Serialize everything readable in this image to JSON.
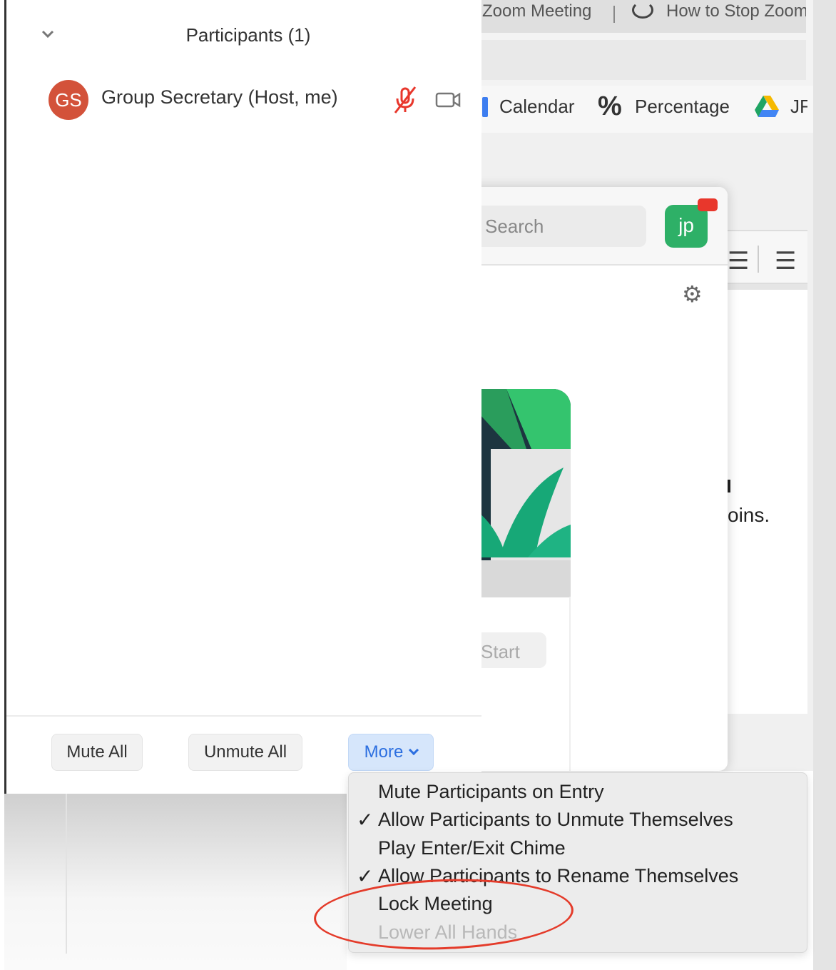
{
  "browser": {
    "tabs": [
      "Zoom Meeting",
      "How to Stop Zoom"
    ],
    "bookmarks": [
      "Calendar",
      "Percentage",
      "JF"
    ]
  },
  "zoom_home": {
    "search_placeholder": "Search",
    "avatar_initials": "jp",
    "start_label": "Start"
  },
  "document": {
    "visible_text": "oins."
  },
  "participants": {
    "title": "Participants (1)",
    "items": [
      {
        "initials": "GS",
        "name": "Group Secretary (Host, me)",
        "avatar_color": "#d3523a",
        "muted": true
      }
    ],
    "footer": {
      "mute_all": "Mute All",
      "unmute_all": "Unmute All",
      "more": "More"
    }
  },
  "more_menu": {
    "items": [
      {
        "label": "Mute Participants on Entry",
        "checked": false,
        "enabled": true
      },
      {
        "label": "Allow Participants to Unmute Themselves",
        "checked": true,
        "enabled": true
      },
      {
        "label": "Play Enter/Exit Chime",
        "checked": false,
        "enabled": true
      },
      {
        "label": "Allow Participants to Rename Themselves",
        "checked": true,
        "enabled": true
      },
      {
        "label": "Lock Meeting",
        "checked": false,
        "enabled": true
      },
      {
        "label": "Lower All Hands",
        "checked": false,
        "enabled": false
      }
    ],
    "highlighted_item": "Lock Meeting",
    "check_glyph": "✓"
  },
  "colors": {
    "zoom_blue": "#2c6fe0",
    "muted_red": "#e8372c",
    "highlight_red": "#e43b2a",
    "zoom_green": "#2eb067"
  }
}
